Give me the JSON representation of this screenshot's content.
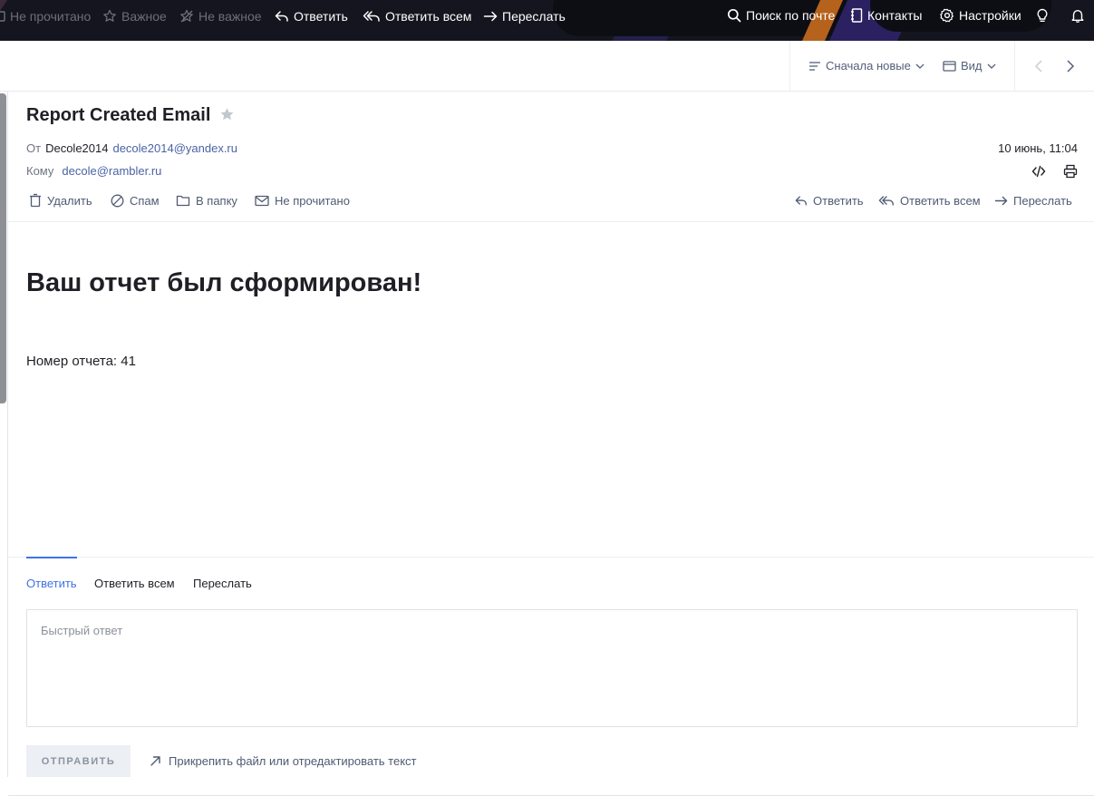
{
  "toolbar": {
    "unread": "Не прочитано",
    "important": "Важное",
    "not_important": "Не важное",
    "reply": "Ответить",
    "reply_all": "Ответить всем",
    "forward": "Переслать",
    "search": "Поиск по почте",
    "contacts": "Контакты",
    "settings": "Настройки",
    "icons": [
      "envelope-icon",
      "star-icon",
      "star-off-icon",
      "reply-icon",
      "reply-all-icon",
      "forward-icon",
      "search-icon",
      "contacts-icon",
      "gear-icon",
      "lightbulb-icon",
      "bell-icon"
    ]
  },
  "subbar": {
    "sort": "Сначала новые",
    "view": "Вид",
    "icons": [
      "sort-icon",
      "chevron-down-icon",
      "view-icon",
      "chevron-left-icon",
      "chevron-right-icon"
    ]
  },
  "message": {
    "subject": "Report Created Email",
    "from_label": "От",
    "from_name": "Decole2014",
    "from_email": "decole2014@yandex.ru",
    "to_label": "Кому",
    "to_email": "decole@rambler.ru",
    "date": "10 июнь, 11:04",
    "icons": [
      "star-icon",
      "code-icon",
      "print-icon"
    ]
  },
  "actions": {
    "delete": "Удалить",
    "spam": "Спам",
    "to_folder": "В папку",
    "unread": "Не прочитано",
    "reply": "Ответить",
    "reply_all": "Ответить всем",
    "forward": "Переслать",
    "icons": [
      "trash-icon",
      "spam-icon",
      "folder-icon",
      "envelope-icon",
      "reply-icon",
      "reply-all-icon",
      "forward-icon"
    ]
  },
  "body": {
    "heading": "Ваш отчет был сформирован!",
    "text": "Номер отчета: 41"
  },
  "reply": {
    "tabs": [
      "Ответить",
      "Ответить всем",
      "Переслать"
    ],
    "active_tab": "Ответить",
    "placeholder": "Быстрый ответ",
    "send": "ОТПРАВИТЬ",
    "attach": "Прикрепить файл или отредактировать текст",
    "icons": [
      "arrow-up-right-icon"
    ]
  },
  "colors": {
    "toolbar_bg": "#15151f",
    "accent": "#3f72e6",
    "link": "#4a63a6",
    "deco_purple": "#2b2160",
    "deco_orange": "#b5621c"
  }
}
